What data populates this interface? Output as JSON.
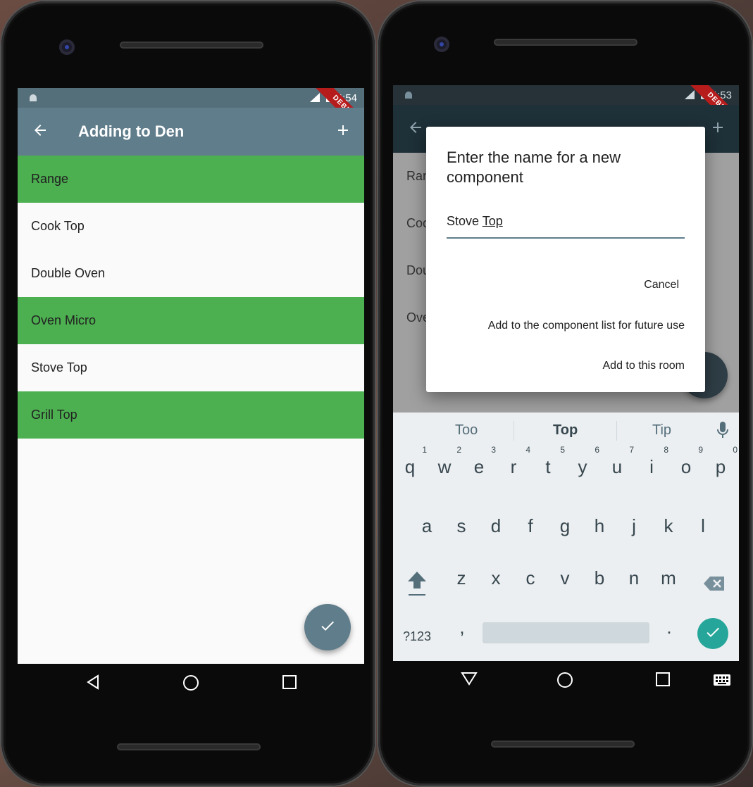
{
  "left": {
    "status": {
      "time": "4:54",
      "debug": "DEBUG"
    },
    "appbar": {
      "title": "Adding to Den"
    },
    "list": [
      {
        "label": "Range",
        "selected": true
      },
      {
        "label": "Cook Top",
        "selected": false
      },
      {
        "label": "Double Oven",
        "selected": false
      },
      {
        "label": "Oven Micro",
        "selected": true
      },
      {
        "label": "Stove Top",
        "selected": false
      },
      {
        "label": "Grill Top",
        "selected": true
      }
    ]
  },
  "right": {
    "status": {
      "time": "4:53",
      "debug": "DEBUG"
    },
    "background_rows": [
      "Ran",
      "Coo",
      "Dou",
      "Ove"
    ],
    "dialog": {
      "title": "Enter the name for a new component",
      "input_prefix": "Stove ",
      "input_underlined": "Top",
      "cancel_label": "Cancel",
      "add_component_label": "Add to the component list for future use",
      "add_room_label": "Add to this room"
    },
    "keyboard": {
      "suggestions": [
        "Too",
        "Top",
        "Tip"
      ],
      "row1": [
        [
          "q",
          "1"
        ],
        [
          "w",
          "2"
        ],
        [
          "e",
          "3"
        ],
        [
          "r",
          "4"
        ],
        [
          "t",
          "5"
        ],
        [
          "y",
          "6"
        ],
        [
          "u",
          "7"
        ],
        [
          "i",
          "8"
        ],
        [
          "o",
          "9"
        ],
        [
          "p",
          "0"
        ]
      ],
      "row2": [
        "a",
        "s",
        "d",
        "f",
        "g",
        "h",
        "j",
        "k",
        "l"
      ],
      "row3": [
        "z",
        "x",
        "c",
        "v",
        "b",
        "n",
        "m"
      ],
      "symbols_label": "?123",
      "comma": ",",
      "period": "."
    }
  },
  "colors": {
    "appbar": "#607d8b",
    "selected_row": "#4caf50",
    "accent_enter": "#26a69a"
  }
}
